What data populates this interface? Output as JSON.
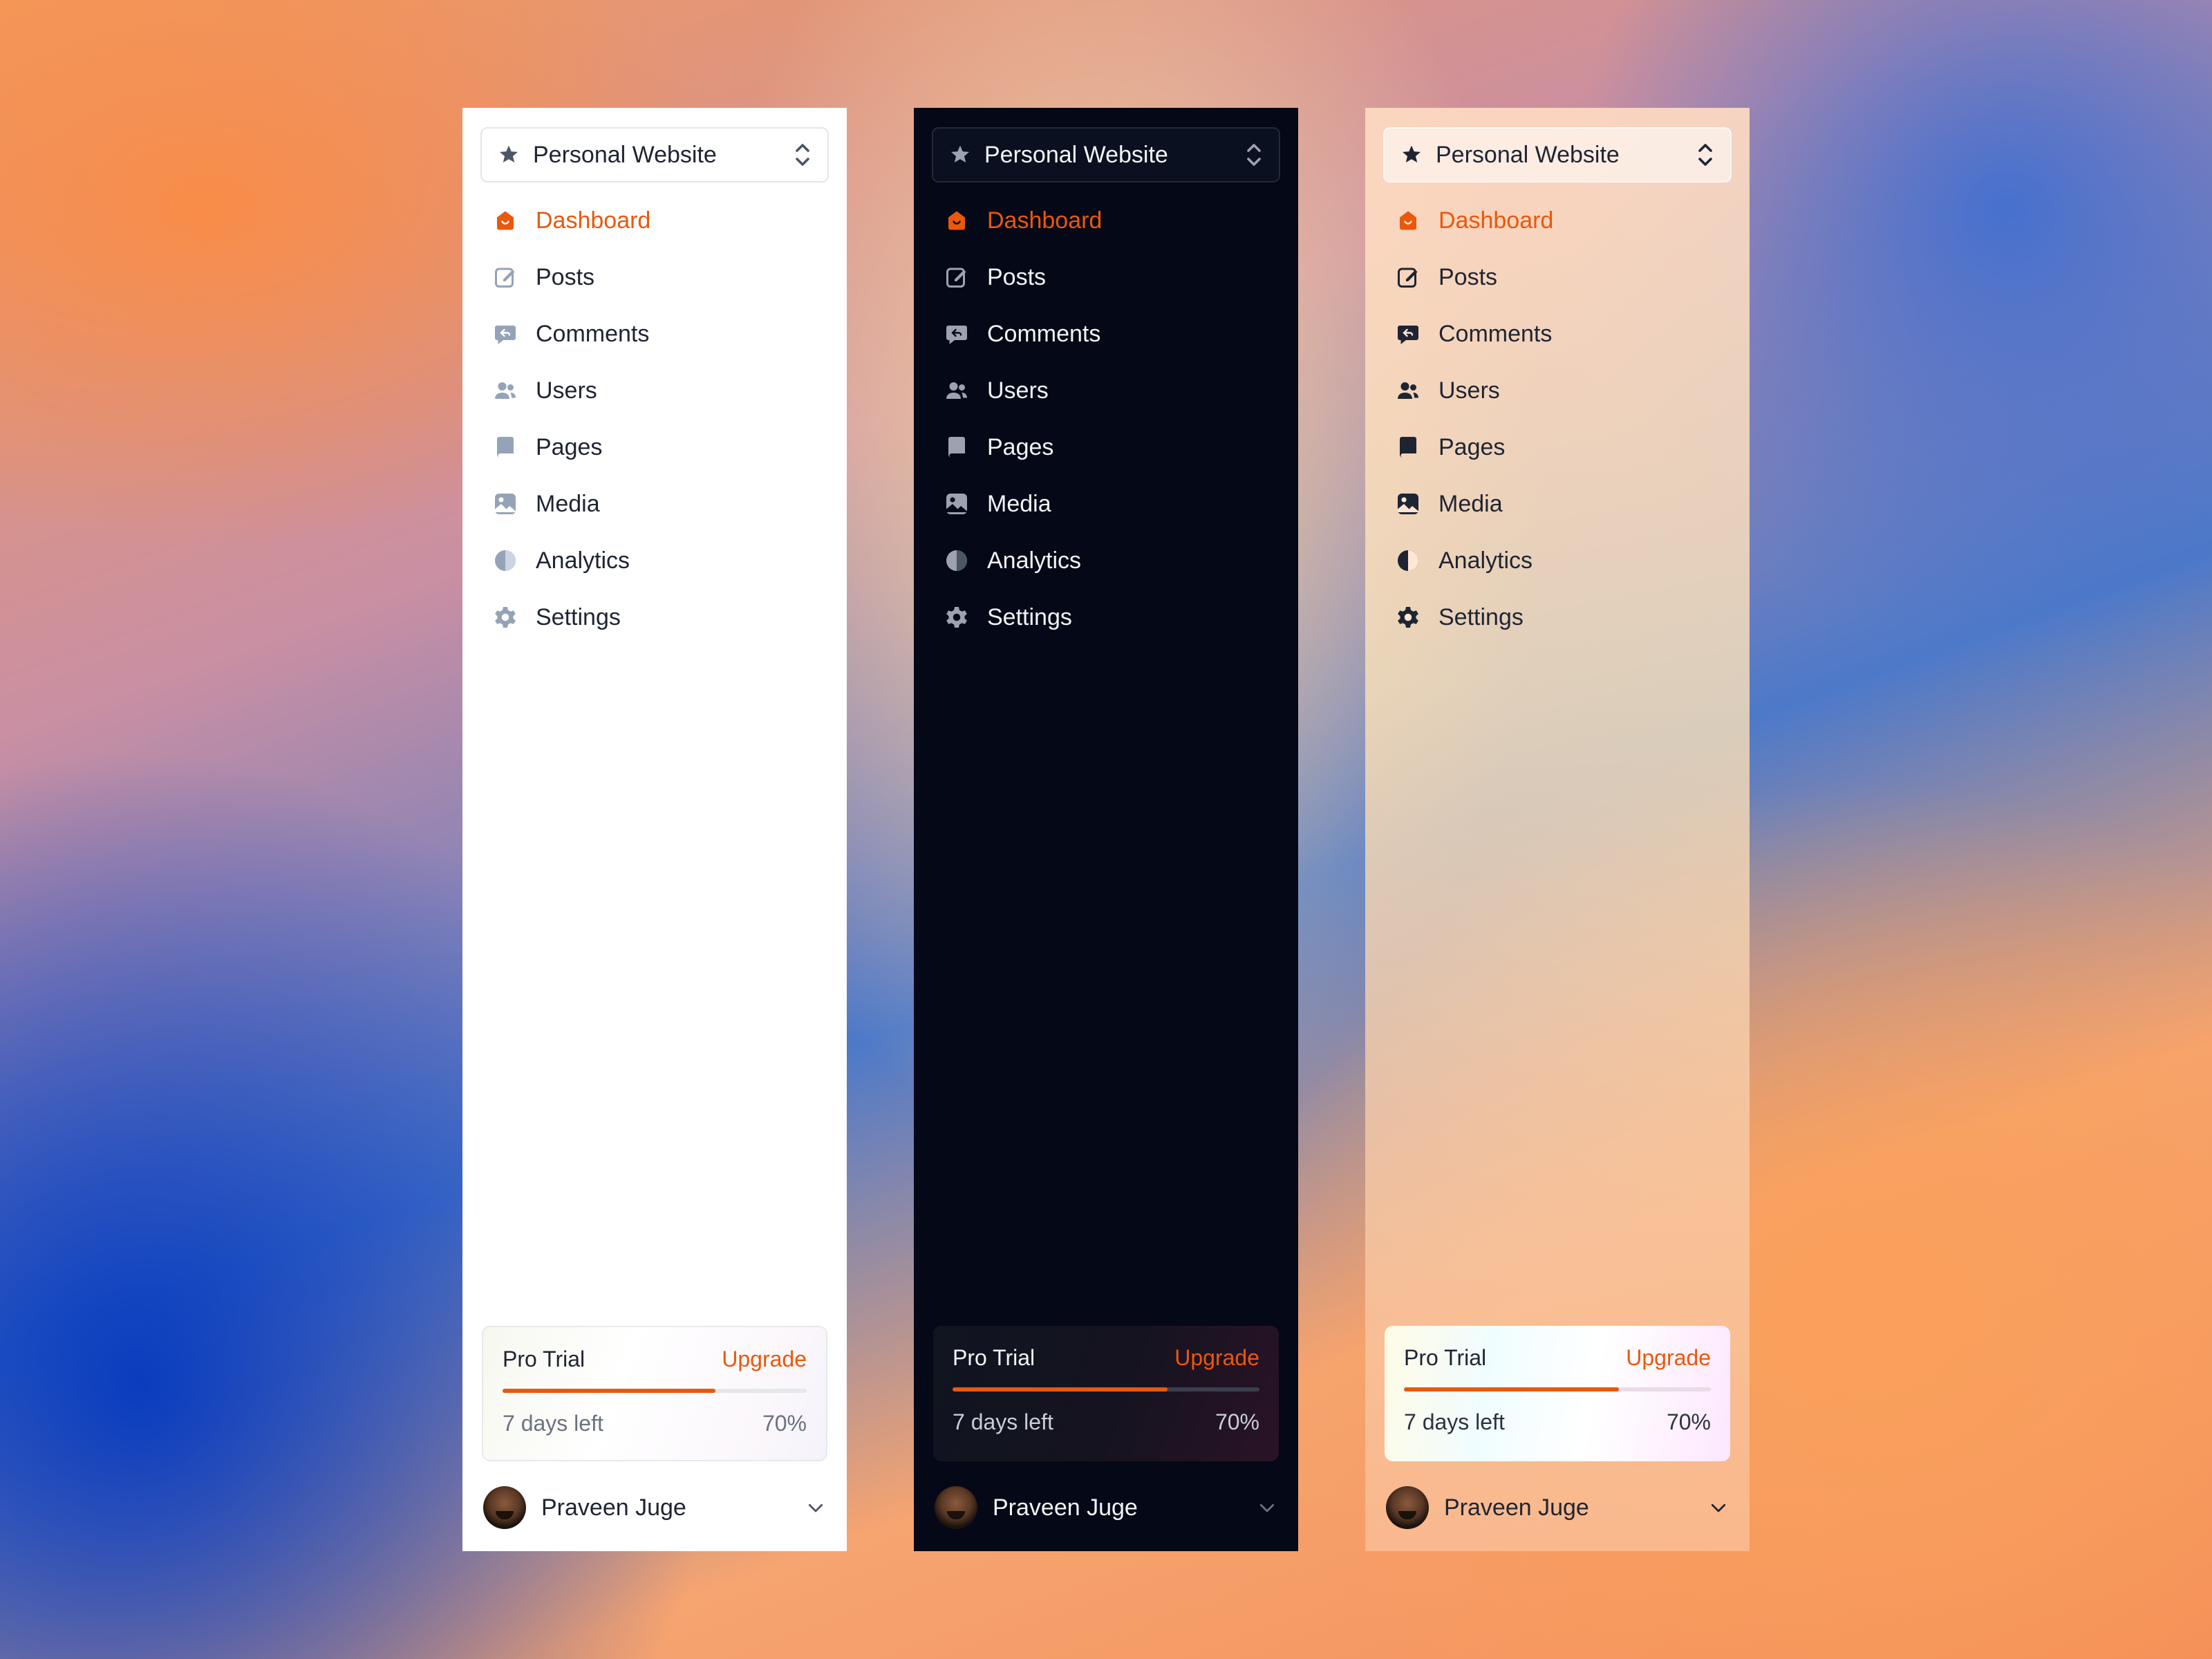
{
  "colors": {
    "accent": "#ea580c",
    "light_icon": "#94a3b8",
    "dark_icon": "#9ca3af",
    "warm_icon": "#1f2433"
  },
  "panels": [
    {
      "theme": "light",
      "site_name": "Personal Website",
      "nav": [
        {
          "label": "Dashboard",
          "icon": "home-icon",
          "active": true
        },
        {
          "label": "Posts",
          "icon": "edit-icon"
        },
        {
          "label": "Comments",
          "icon": "chat-icon"
        },
        {
          "label": "Users",
          "icon": "users-icon"
        },
        {
          "label": "Pages",
          "icon": "book-icon"
        },
        {
          "label": "Media",
          "icon": "image-icon"
        },
        {
          "label": "Analytics",
          "icon": "pie-icon"
        },
        {
          "label": "Settings",
          "icon": "gear-icon"
        }
      ],
      "trial": {
        "title": "Pro Trial",
        "upgrade": "Upgrade",
        "days_left": "7 days left",
        "percent_label": "70%",
        "progress": 0.7
      },
      "user": {
        "name": "Praveen Juge"
      }
    },
    {
      "theme": "dark",
      "site_name": "Personal Website",
      "nav": [
        {
          "label": "Dashboard",
          "icon": "home-icon",
          "active": true
        },
        {
          "label": "Posts",
          "icon": "edit-icon"
        },
        {
          "label": "Comments",
          "icon": "chat-icon"
        },
        {
          "label": "Users",
          "icon": "users-icon"
        },
        {
          "label": "Pages",
          "icon": "book-icon"
        },
        {
          "label": "Media",
          "icon": "image-icon"
        },
        {
          "label": "Analytics",
          "icon": "pie-icon"
        },
        {
          "label": "Settings",
          "icon": "gear-icon"
        }
      ],
      "trial": {
        "title": "Pro Trial",
        "upgrade": "Upgrade",
        "days_left": "7 days left",
        "percent_label": "70%",
        "progress": 0.7
      },
      "user": {
        "name": "Praveen Juge"
      }
    },
    {
      "theme": "warm",
      "site_name": "Personal Website",
      "nav": [
        {
          "label": "Dashboard",
          "icon": "home-icon",
          "active": true
        },
        {
          "label": "Posts",
          "icon": "edit-icon"
        },
        {
          "label": "Comments",
          "icon": "chat-icon"
        },
        {
          "label": "Users",
          "icon": "users-icon"
        },
        {
          "label": "Pages",
          "icon": "book-icon"
        },
        {
          "label": "Media",
          "icon": "image-icon"
        },
        {
          "label": "Analytics",
          "icon": "pie-icon"
        },
        {
          "label": "Settings",
          "icon": "gear-icon"
        }
      ],
      "trial": {
        "title": "Pro Trial",
        "upgrade": "Upgrade",
        "days_left": "7 days left",
        "percent_label": "70%",
        "progress": 0.7
      },
      "user": {
        "name": "Praveen Juge"
      }
    }
  ]
}
